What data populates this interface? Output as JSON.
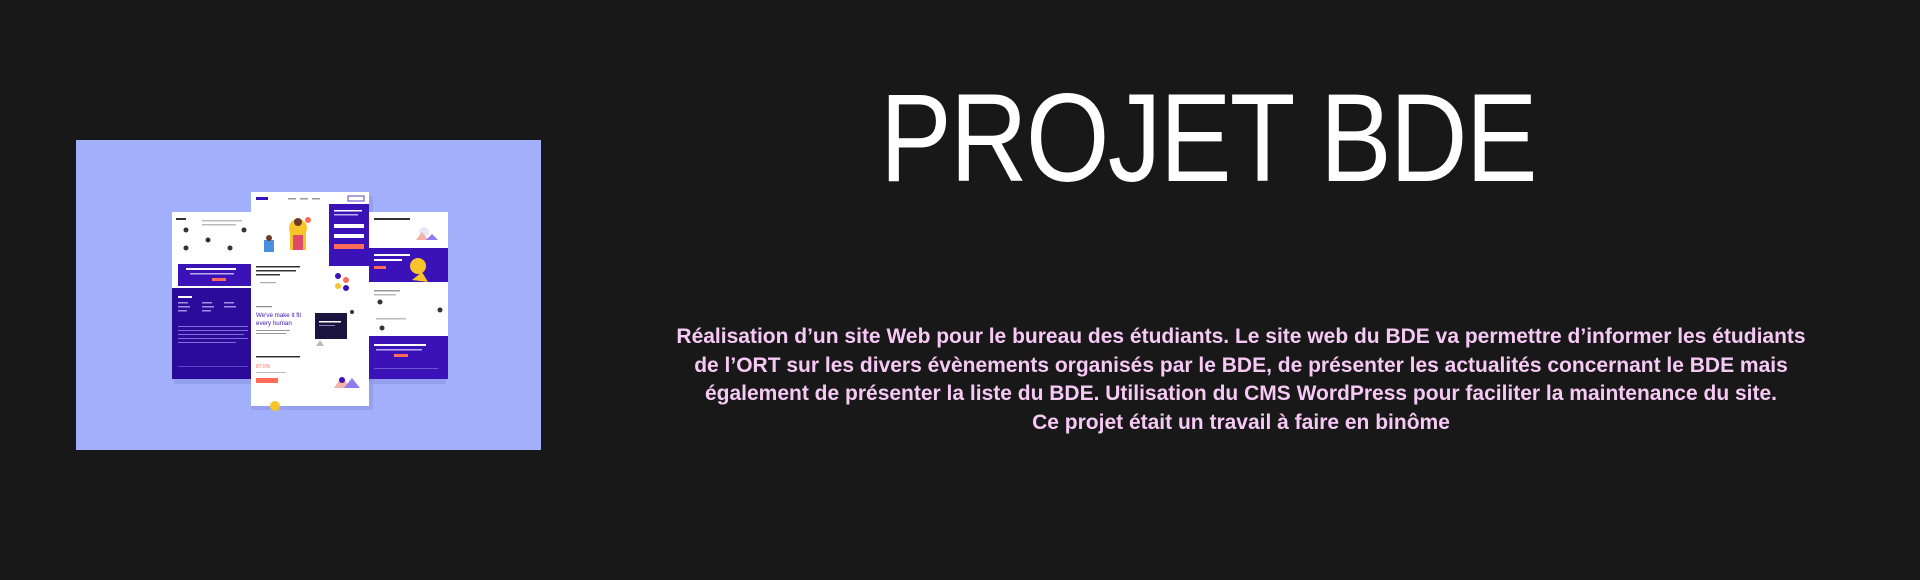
{
  "project": {
    "title": "PROJET BDE",
    "description_lines": [
      "Réalisation d’un site Web pour le bureau des étudiants. Le site web du BDE va permettre d’informer les étudiants",
      "de l’ORT sur les divers évènements organisés par le BDE, de présenter les actualités concernant le BDE mais",
      "également de présenter la liste du BDE. Utilisation du CMS WordPress pour faciliter la maintenance du site.",
      "Ce projet était un travail à faire en binôme"
    ],
    "preview": {
      "background_color": "#a2b0fb",
      "headline_lines": [
        "We've make it fit",
        "every human"
      ],
      "percent_text": "87.5%"
    }
  },
  "colors": {
    "page_background": "#181818",
    "title_color": "#ffffff",
    "description_color": "#f7c9f5",
    "brand_purple": "#3b12b8"
  }
}
